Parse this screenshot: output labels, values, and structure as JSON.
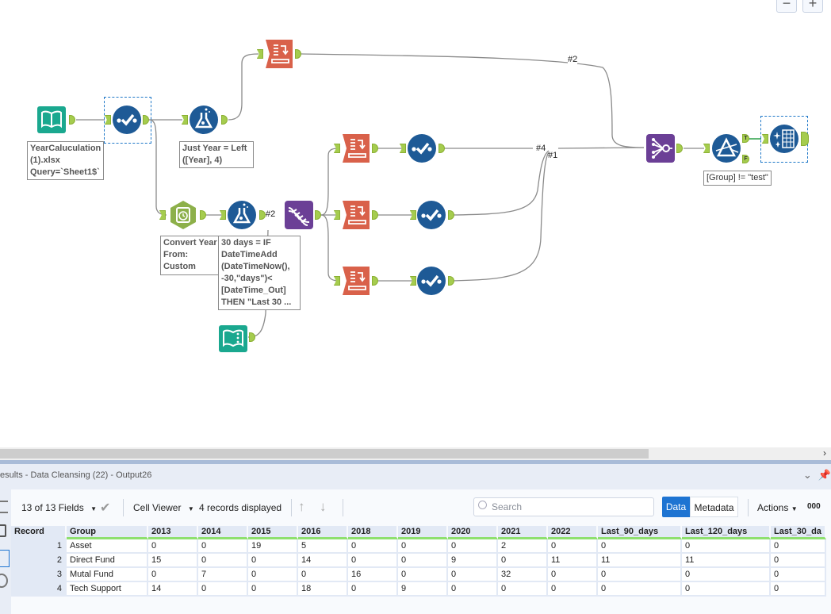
{
  "canvas": {
    "zoom_out_label": "−",
    "zoom_in_label": "+",
    "tools": [
      {
        "id": "input1",
        "type": "input-data",
        "icon": "book-icon",
        "color": "#1aa88f"
      },
      {
        "id": "select1",
        "type": "select",
        "icon": "check-circle-icon",
        "color": "#1e5a96"
      },
      {
        "id": "formula1",
        "type": "formula",
        "icon": "flask-icon",
        "color": "#1e5a96"
      },
      {
        "id": "crosstab1",
        "type": "cross-tab",
        "icon": "crosstab-icon",
        "color": "#d9614a"
      },
      {
        "id": "datetime1",
        "type": "datetime",
        "icon": "clock-icon",
        "color": "#8db04a"
      },
      {
        "id": "formula2",
        "type": "formula",
        "icon": "flask-icon",
        "color": "#1e5a96"
      },
      {
        "id": "textinput1",
        "type": "text-input",
        "icon": "book-icon",
        "color": "#1aa88f"
      },
      {
        "id": "transpose1",
        "type": "dna",
        "icon": "dna-icon",
        "color": "#6b3f96"
      },
      {
        "id": "crosstab2",
        "type": "cross-tab",
        "icon": "crosstab-icon",
        "color": "#d9614a"
      },
      {
        "id": "crosstab3",
        "type": "cross-tab",
        "icon": "crosstab-icon",
        "color": "#d9614a"
      },
      {
        "id": "crosstab4",
        "type": "cross-tab",
        "icon": "crosstab-icon",
        "color": "#d9614a"
      },
      {
        "id": "select2",
        "type": "select",
        "icon": "check-circle-icon",
        "color": "#1e5a96"
      },
      {
        "id": "select3",
        "type": "select",
        "icon": "check-circle-icon",
        "color": "#1e5a96"
      },
      {
        "id": "select4",
        "type": "select",
        "icon": "check-circle-icon",
        "color": "#1e5a96"
      },
      {
        "id": "join1",
        "type": "join-multiple",
        "icon": "join-icon",
        "color": "#6b3f96"
      },
      {
        "id": "filter1",
        "type": "filter",
        "icon": "prism-icon",
        "color": "#1e5a96"
      },
      {
        "id": "cleanse1",
        "type": "data-cleansing",
        "icon": "sparkle-table-icon",
        "color": "#1e5a96"
      }
    ],
    "annotations": {
      "input1": [
        "YearCaluculation",
        "(1).xlsx",
        "Query=`Sheet1$`"
      ],
      "formula1": [
        "Just Year = Left",
        "([Year], 4)"
      ],
      "datetime1": [
        "Convert Year",
        "From:",
        "Custom"
      ],
      "formula2": [
        "30 days = IF",
        "DateTimeAdd",
        "(DateTimeNow(),",
        "-30,\"days\")<",
        "[DateTime_Out]",
        "THEN \"Last 30 ..."
      ],
      "filter1": [
        "[Group] != \"test\""
      ]
    },
    "wire_labels": {
      "top": "#2",
      "join4": "#4",
      "join1": "#1",
      "dna2": "#2"
    },
    "filter_anchors": {
      "true": "T",
      "false": "F"
    }
  },
  "results": {
    "title": "esults - Data Cleansing (22) - Output26",
    "fields_label": "13 of 13 Fields",
    "cell_viewer_label": "Cell Viewer",
    "records_label": "4 records displayed",
    "search_placeholder": "Search",
    "data_tab": "Data",
    "metadata_tab": "Metadata",
    "actions_label": "Actions",
    "extra_label": "000",
    "columns": [
      "Record",
      "Group",
      "2013",
      "2014",
      "2015",
      "2016",
      "2018",
      "2019",
      "2020",
      "2021",
      "2022",
      "Last_90_days",
      "Last_120_days",
      "Last_30_da"
    ],
    "rows": [
      [
        "1",
        "Asset",
        "0",
        "0",
        "19",
        "5",
        "0",
        "0",
        "0",
        "2",
        "0",
        "0",
        "0",
        "0"
      ],
      [
        "2",
        "Direct Fund",
        "15",
        "0",
        "0",
        "14",
        "0",
        "0",
        "9",
        "0",
        "11",
        "11",
        "11",
        "0"
      ],
      [
        "3",
        "Mutal Fund",
        "0",
        "7",
        "0",
        "0",
        "16",
        "0",
        "0",
        "32",
        "0",
        "0",
        "0",
        "0"
      ],
      [
        "4",
        "Tech Support",
        "14",
        "0",
        "0",
        "18",
        "0",
        "9",
        "0",
        "0",
        "0",
        "0",
        "0",
        "0"
      ]
    ]
  }
}
